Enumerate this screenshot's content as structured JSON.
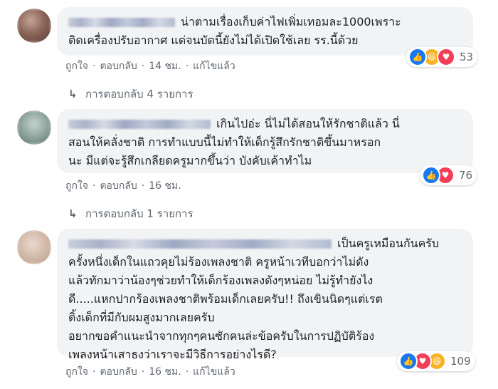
{
  "actions": {
    "like": "ถูกใจ",
    "reply": "ตอบกลับ",
    "dot": "·",
    "edited": "แก้ไขแล้ว"
  },
  "comments": [
    {
      "lines": [
        "น่าตามเรื่องเก็บค่าไฟเพิ่มเทอมละ1000เพราะ",
        "ติดเครื่องปรับอากาศ แต่จนบัดนี้ยังไม่ได้เปิดใช้เลย รร.นี้ด้วย"
      ],
      "reactions": [
        "like",
        "haha",
        "love"
      ],
      "reaction_count": "53",
      "time": "14 ชม.",
      "edited": true,
      "replies": "การตอบกลับ 4 รายการ"
    },
    {
      "lines": [
        "เกินไปอ่ะ นี่ไม่ได้สอนให้รักชาติแล้ว นี่",
        "สอนให้คลั่งชาติ การทำแบบนี้ไม่ทำให้เด็กรู้สึกรักชาติขึ้นมาหรอก",
        "นะ มีแต่จะรู้สึกเกลียดครูมากขึ้นว่า บังคับเค้าทำไม"
      ],
      "reactions": [
        "like",
        "love"
      ],
      "reaction_count": "76",
      "time": "16 ชม.",
      "edited": false,
      "replies": "การตอบกลับ 1 รายการ"
    },
    {
      "lines": [
        "เป็นครูเหมือนกันครับ",
        "ครั้งหนึ่งเด็กในแถวคุยไม่ร้องเพลงชาติ ครูหน้าเวทีบอกว่าไม่ดัง",
        "แล้วทักมาว่าน้องๆช่วยทำให้เด็กร้องเพลงดังๆหน่อย ไม่รู้ทำยังไง",
        "ดี.....แหกปากร้องเพลงชาติพร้อมเด็กเลยครับ!! ถึงเขินนิดๆแต่เรต",
        "ติ้งเด็กที่มีกับผมสูงมากเลยครับ",
        "อยากขอคำแนะนำจากทุกๆคนซักคนล่ะข้อครับในการปฏิบัติร้อง",
        "เพลงหน้าเสาธงว่าเราจะมีวิธีการอย่างไรดี?"
      ],
      "reactions": [
        "like",
        "love",
        "haha"
      ],
      "reaction_count": "109",
      "time": "16 ชม.",
      "edited": true,
      "replies": ""
    }
  ],
  "icons": {
    "like": "like-icon",
    "love": "love-icon",
    "haha": "haha-icon",
    "reply_arrow": "reply-arrow-icon"
  },
  "colors": {
    "like": "#1877f2",
    "love": "#f33e58",
    "haha": "#f7b125",
    "meta": "#606770",
    "bubble": "#f2f3f5"
  }
}
